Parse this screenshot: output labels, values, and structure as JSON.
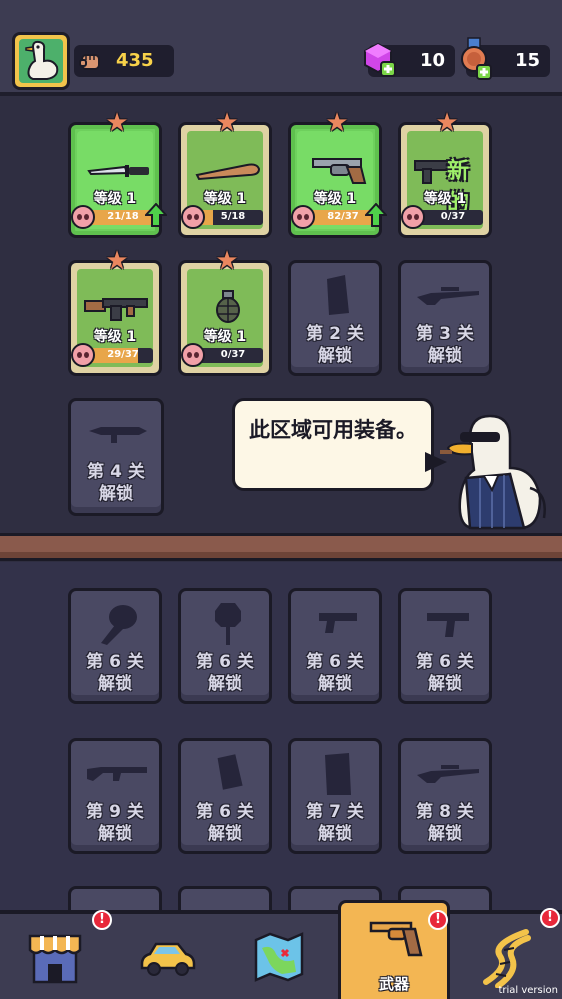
{
  "header": {
    "power": "435",
    "gems": "10",
    "medals": "15"
  },
  "unlocked_weapons": [
    {
      "id": "knife",
      "level": "等级 1",
      "progress": "21/18",
      "fill": 1.0,
      "style": "green",
      "upgradeable": true,
      "is_new": false
    },
    {
      "id": "bat",
      "level": "等级 1",
      "progress": "5/18",
      "fill": 0.28,
      "style": "tan",
      "upgradeable": false,
      "is_new": false
    },
    {
      "id": "revolver",
      "level": "等级 1",
      "progress": "82/37",
      "fill": 1.0,
      "style": "green",
      "upgradeable": true,
      "is_new": false
    },
    {
      "id": "smg",
      "level": "等级 1",
      "progress": "0/37",
      "fill": 0.0,
      "style": "tan",
      "upgradeable": false,
      "is_new": true,
      "new_label": "新的"
    },
    {
      "id": "tommy-gun",
      "level": "等级 1",
      "progress": "29/37",
      "fill": 0.78,
      "style": "tan",
      "upgradeable": false,
      "is_new": false
    },
    {
      "id": "grenade",
      "level": "等级 1",
      "progress": "0/37",
      "fill": 0.0,
      "style": "tan",
      "upgradeable": false,
      "is_new": false
    }
  ],
  "locked_top": [
    {
      "icon": "shield",
      "line1": "第 2 关",
      "line2": "解锁"
    },
    {
      "icon": "sniper",
      "line1": "第 3 关",
      "line2": "解锁"
    },
    {
      "icon": "rocket",
      "line1": "第 4 关",
      "line2": "解锁"
    }
  ],
  "speech": "此区域可用装备。",
  "locked_bottom": [
    {
      "icon": "drumstick",
      "line1": "第 6 关",
      "line2": "解锁"
    },
    {
      "icon": "sign",
      "line1": "第 6 关",
      "line2": "解锁"
    },
    {
      "icon": "pistol",
      "line1": "第 6 关",
      "line2": "解锁"
    },
    {
      "icon": "uzi",
      "line1": "第 6 关",
      "line2": "解锁"
    },
    {
      "icon": "ak",
      "line1": "第 9 关",
      "line2": "解锁"
    },
    {
      "icon": "pan",
      "line1": "第 6 关",
      "line2": "解锁"
    },
    {
      "icon": "riot-shield",
      "line1": "第 7 关",
      "line2": "解锁"
    },
    {
      "icon": "sniper",
      "line1": "第 8 关",
      "line2": "解锁"
    }
  ],
  "nav": {
    "active_label": "武器",
    "badge": "!",
    "trial": "trial version"
  },
  "colors": {
    "background": "#2f2e41",
    "card_green": "#78dc66",
    "card_tan": "#dfd2a3",
    "card_locked": "#4a4963",
    "accent_yellow": "#f3b653",
    "shelf": "#8a5a4c"
  }
}
